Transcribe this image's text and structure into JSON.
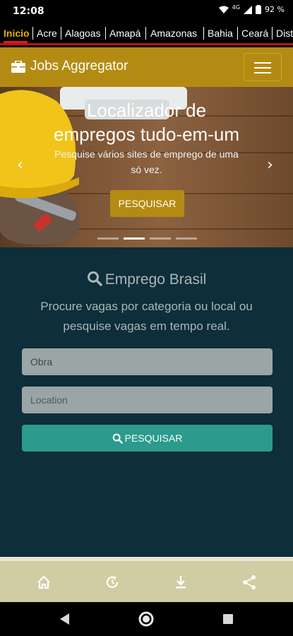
{
  "status": {
    "time": "12:08",
    "network": "4G",
    "battery": "92 %"
  },
  "tabs": [
    "Inicio",
    "Acre",
    "Alagoas",
    "Amapá",
    "Amazonas",
    "Bahia",
    "Ceará",
    "Dist"
  ],
  "appbar": {
    "title": "Jobs Aggregator",
    "icon": "briefcase-icon",
    "menu_icon": "hamburger-menu-icon"
  },
  "hero": {
    "title_line1": "Localizador de",
    "title_line2": "empregos tudo-em-um",
    "subtitle_line1": "Pesquise vários sites de emprego de uma",
    "subtitle_line2": "só vez.",
    "button": "PESQUISAR",
    "slides": 4,
    "active_slide": 2
  },
  "search": {
    "title": "Emprego Brasil",
    "desc_line1": "Procure vagas por categoria ou local ou",
    "desc_line2": "pesquise vagas em tempo real.",
    "job_value": "Obra",
    "location_placeholder": "Location",
    "submit": "PESQUISAR"
  },
  "bottom_nav": [
    "home-icon",
    "refresh-icon",
    "download-icon",
    "share-icon"
  ],
  "colors": {
    "gold": "#b48b12",
    "teal": "#2c9a8c",
    "dark": "#0e2e39",
    "beige": "#d0cca3",
    "red": "#e01b14"
  }
}
